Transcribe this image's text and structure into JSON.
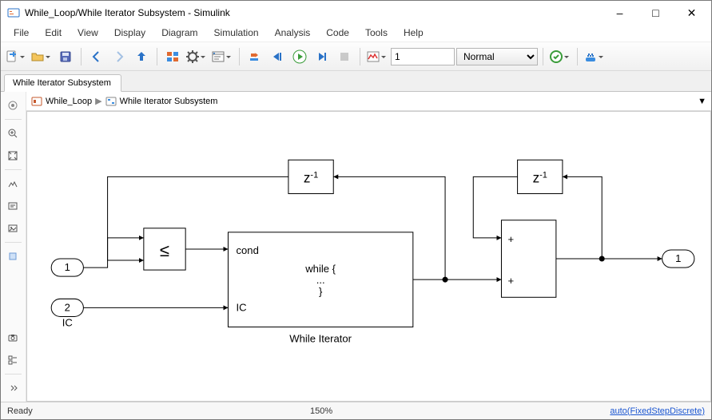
{
  "window": {
    "title": "While_Loop/While Iterator Subsystem - Simulink"
  },
  "menu": {
    "file": "File",
    "edit": "Edit",
    "view": "View",
    "display": "Display",
    "diagram": "Diagram",
    "simulation": "Simulation",
    "analysis": "Analysis",
    "code": "Code",
    "tools": "Tools",
    "help": "Help"
  },
  "toolbar": {
    "stop_time_value": "1",
    "sim_mode": "Normal"
  },
  "tab": {
    "label": "While Iterator Subsystem"
  },
  "breadcrumb": {
    "root": "While_Loop",
    "sub": "While Iterator Subsystem"
  },
  "status": {
    "ready": "Ready",
    "zoom": "150%",
    "solver": "auto(FixedStepDiscrete)"
  },
  "chart_data": {
    "type": "simulink_block_diagram",
    "ports": [
      {
        "kind": "Inport",
        "index": 1,
        "name": ""
      },
      {
        "kind": "Inport",
        "index": 2,
        "name": "IC"
      },
      {
        "kind": "Outport",
        "index": 1,
        "name": ""
      }
    ],
    "blocks": [
      {
        "id": "delay1",
        "type": "UnitDelay",
        "label": "z⁻¹"
      },
      {
        "id": "delay2",
        "type": "UnitDelay",
        "label": "z⁻¹"
      },
      {
        "id": "cmp",
        "type": "RelationalOperator",
        "operator": "≤"
      },
      {
        "id": "while",
        "type": "WhileIterator",
        "label": "While Iterator",
        "body_text": "while {\n  ...\n}",
        "port_labels": {
          "top": "cond",
          "bottom": "IC"
        }
      },
      {
        "id": "sum",
        "type": "Sum",
        "inputs": "++"
      }
    ],
    "connections": [
      {
        "from": "In1",
        "to": "cmp.in1"
      },
      {
        "from": "delay1.out",
        "to": "cmp.in2"
      },
      {
        "from": "cmp.out",
        "to": "while.cond"
      },
      {
        "from": "In2",
        "to": "while.IC"
      },
      {
        "from": "while.out",
        "to": "delay1.in"
      },
      {
        "from": "while.out",
        "to": "sum.in2"
      },
      {
        "from": "delay2.out",
        "to": "sum.in1"
      },
      {
        "from": "sum.out",
        "to": "delay2.in"
      },
      {
        "from": "sum.out",
        "to": "Out1"
      }
    ]
  }
}
